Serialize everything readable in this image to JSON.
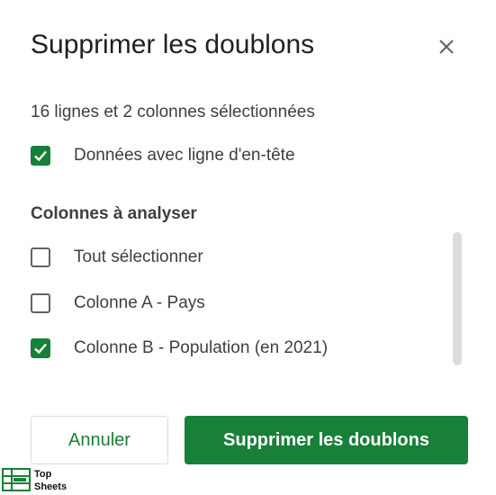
{
  "dialog": {
    "title": "Supprimer les doublons",
    "close_icon": "close-icon",
    "summary": "16 lignes et 2 colonnes sélectionnées",
    "header_option": {
      "label": "Données avec ligne d'en-tête",
      "checked": true
    },
    "columns_heading": "Colonnes à analyser",
    "columns": [
      {
        "label": "Tout sélectionner",
        "checked": false
      },
      {
        "label": "Colonne A - Pays",
        "checked": false
      },
      {
        "label": "Colonne B - Population (en 2021)",
        "checked": true
      }
    ],
    "buttons": {
      "cancel_label": "Annuler",
      "confirm_label": "Supprimer les doublons"
    }
  },
  "watermark": {
    "line1": "Top",
    "line2": "Sheets"
  },
  "colors": {
    "accent": "#188038",
    "text": "#3c4043",
    "title": "#202124",
    "border": "#dadce0",
    "checkbox_border": "#5f6368"
  }
}
